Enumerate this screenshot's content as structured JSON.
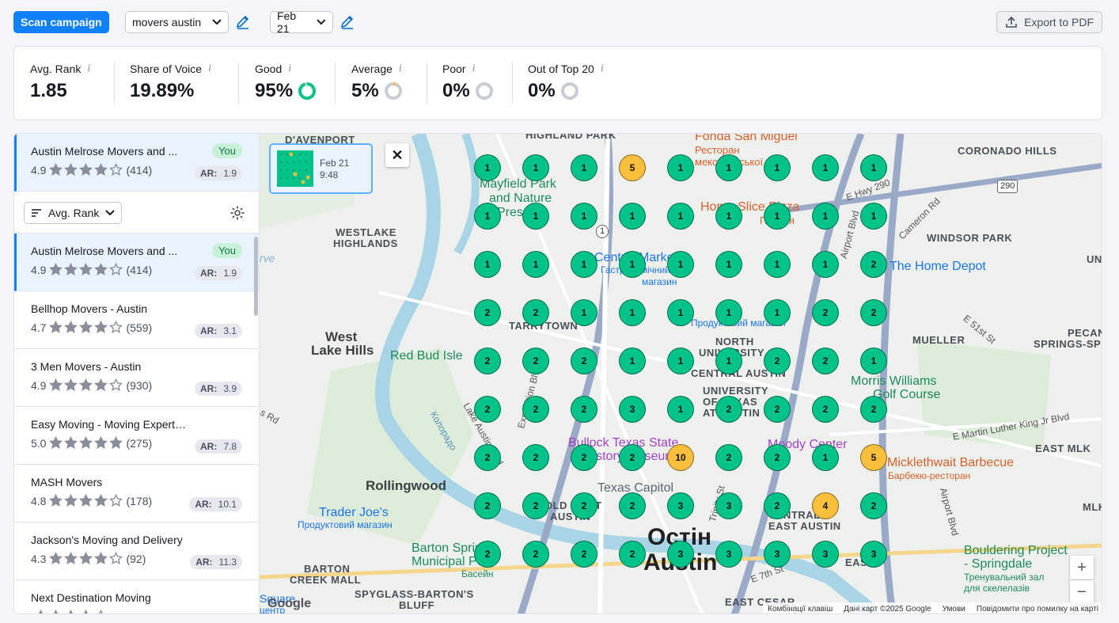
{
  "toolbar": {
    "scan_label": "Scan campaign",
    "keyword": "movers austin",
    "date": "Feb 21",
    "export_label": "Export to PDF"
  },
  "stats": [
    {
      "label": "Avg. Rank",
      "value": "1.85"
    },
    {
      "label": "Share of Voice",
      "value": "19.89%"
    },
    {
      "label": "Good",
      "value": "95%",
      "fraction": 0.95,
      "color": "#00c389"
    },
    {
      "label": "Average",
      "value": "5%",
      "fraction": 0.05,
      "color": "#fbbf3b"
    },
    {
      "label": "Poor",
      "value": "0%",
      "fraction": 0
    },
    {
      "label": "Out of Top 20",
      "value": "0%",
      "fraction": 0
    }
  ],
  "info_glyph": "i",
  "selected": {
    "name": "Austin Melrose Movers and ...",
    "rating": "4.9",
    "stars": 4,
    "reviews": "(414)",
    "badge": "You",
    "ar_label": "AR:",
    "ar": "1.9"
  },
  "sort": {
    "label": "Avg. Rank"
  },
  "competitors": [
    {
      "name": "Austin Melrose Movers and ...",
      "rating": "4.9",
      "stars": 4,
      "reviews": "(414)",
      "ar": "1.9",
      "you": true
    },
    {
      "name": "Bellhop Movers - Austin",
      "rating": "4.7",
      "stars": 4,
      "reviews": "(559)",
      "ar": "3.1"
    },
    {
      "name": "3 Men Movers - Austin",
      "rating": "4.9",
      "stars": 4,
      "reviews": "(930)",
      "ar": "3.9"
    },
    {
      "name": "Easy Moving - Moving Experts in A...",
      "rating": "5.0",
      "stars": 5,
      "reviews": "(275)",
      "ar": "7.8"
    },
    {
      "name": "MASH Movers",
      "rating": "4.8",
      "stars": 4,
      "reviews": "(178)",
      "ar": "10.1"
    },
    {
      "name": "Jackson's Moving and Delivery",
      "rating": "4.3",
      "stars": 4,
      "reviews": "(92)",
      "ar": "11.3"
    },
    {
      "name": "Next Destination Moving",
      "rating": "",
      "stars": 4,
      "reviews": "",
      "ar": ""
    }
  ],
  "you_badge": "You",
  "ar_label": "AR:",
  "thumb": {
    "date": "Feb 21",
    "time": "9:48"
  },
  "grid": [
    [
      1,
      1,
      1,
      5,
      1,
      1,
      1,
      1,
      1
    ],
    [
      1,
      1,
      1,
      1,
      1,
      1,
      1,
      1,
      1
    ],
    [
      1,
      1,
      1,
      1,
      1,
      1,
      1,
      1,
      2
    ],
    [
      2,
      2,
      1,
      1,
      1,
      1,
      1,
      2,
      2
    ],
    [
      2,
      2,
      2,
      1,
      1,
      1,
      2,
      2,
      1
    ],
    [
      2,
      2,
      2,
      3,
      1,
      2,
      2,
      2,
      2
    ],
    [
      2,
      2,
      2,
      2,
      10,
      2,
      2,
      1,
      5
    ],
    [
      2,
      2,
      2,
      2,
      3,
      3,
      2,
      4,
      2
    ],
    [
      2,
      2,
      2,
      2,
      3,
      3,
      3,
      3,
      3
    ]
  ],
  "map_labels": {
    "davenport": "D'AVENPORT",
    "highland_park": "HIGHLAND PARK",
    "fonda": "Fonda San Miguel",
    "fonda_sub1": "Ресторан",
    "fonda_sub2": "мексиканської кухні",
    "coronado": "CORONADO HILLS",
    "mayfield1": "Mayfield Park",
    "mayfield2": "and Nature",
    "mayfield3": "Preserve",
    "westlake1": "WESTLAKE",
    "westlake2": "HIGHLANDS",
    "homeslice": "Home Slice Pizza",
    "homeslice_sub": "Піцерія",
    "windsor": "WINDSOR PARK",
    "cameron": "Cameron Rd",
    "airport": "Airport Blvd",
    "central1": "Central Market",
    "central2": "Гастрономічний",
    "central3": "магазин",
    "homedepot": "The Home Depot",
    "hemp": "E Hwy 290",
    "west_lake1": "West",
    "west_lake2": "Lake Hills",
    "tarrytown": "TARRYTOWN",
    "product_store": "Продуктовий магазин",
    "redbud": "Red Bud Isle",
    "north_univ1": "NORTH",
    "north_univ2": "UNIVERSITY",
    "central_austin": "CENTRAL AUSTIN",
    "mueller": "MUELLER",
    "e51": "E 51st St",
    "pecan1": "PECAN",
    "pecan2": "SPRINGS-SPRIN",
    "univ1": "UNIVERSITY",
    "univ2": "OF TEXAS",
    "univ3": "AT AUSTIN",
    "morris1": "Morris Williams",
    "morris2": "Golf Course",
    "colorado": "Колорадо",
    "exposition": "Exposition Blvd",
    "lake_austin": "Lake Austin Blvd",
    "bullock1": "Bullock Texas State",
    "bullock2": "History Museum",
    "moody": "Moody Center",
    "mlk": "E Martin Luther King Jr Blvd",
    "east_mlk": "EAST MLK",
    "micklethwait": "Micklethwait Barbecue",
    "micklethwait_sub": "Барбекю-ресторан",
    "rollingwood": "Rollingwood",
    "capitol": "Texas Capitol",
    "traderjoes": "Trader Joe's",
    "traderjoes_sub": "Продуктовий магазин",
    "old_west1": "OLD WEST",
    "old_west2": "AUSTIN",
    "central_east1": "CENTRAL",
    "central_east2": "EAST AUSTIN",
    "city1": "Остін",
    "city2": "Austin",
    "barton1": "Barton Springs",
    "barton2": "Municipal Pool",
    "barton_sub": "Басейн",
    "bouldering1": "Bouldering Project",
    "bouldering2": "- Springdale",
    "bouldering_sub1": "Тренувальний зал",
    "bouldering_sub2": "для скелелазів",
    "barton_creek1": "BARTON",
    "barton_creek2": "CREEK MALL",
    "spyglass1": "SPYGLASS-BARTON'S",
    "spyglass2": "BLUFF",
    "east_cesar": "EAST CESAR",
    "e7th": "E 7th St",
    "east": "EAST",
    "trinity": "Trinity St",
    "mlk_short": "MLK",
    "unive_edge": "UNI",
    "hwy1": "1",
    "hwy290": "290",
    "google": "Google",
    "square1": "Square",
    "square2": "центр",
    "rve": "rve",
    "rd_left": "s Rd"
  },
  "map_footer": {
    "keys": "Комбінації клавіш",
    "data": "Дані карт ©2025 Google",
    "terms": "Умови",
    "report": "Повідомити про помилку на карті"
  },
  "zoom": {
    "in": "+",
    "out": "−"
  },
  "close": "✕",
  "colors": {
    "accent": "#1080ff",
    "good": "#00c389",
    "average": "#fbbf3b",
    "star": "#8a8e9b"
  }
}
